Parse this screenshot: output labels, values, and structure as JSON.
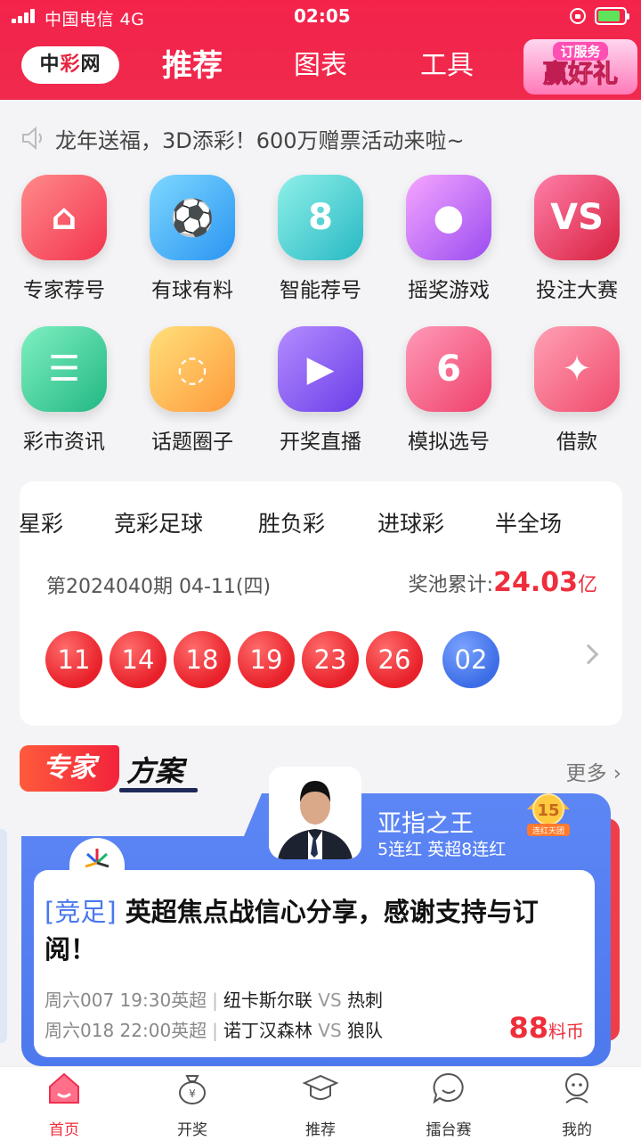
{
  "status_bar": {
    "carrier": "中国电信  4G",
    "time": "02:05"
  },
  "header": {
    "logo": {
      "part1": "中",
      "part2": "彩",
      "part3": "网"
    },
    "tabs": [
      {
        "label": "推荐"
      },
      {
        "label": "图表"
      },
      {
        "label": "工具"
      }
    ],
    "promo": {
      "line1": "订服务",
      "line2": "赢好礼"
    }
  },
  "notice": {
    "text": "龙年送福，3D添彩！600万赠票活动来啦~"
  },
  "grid": {
    "items": [
      {
        "label": "专家荐号",
        "icon": "house-icon"
      },
      {
        "label": "有球有料",
        "icon": "football-icon"
      },
      {
        "label": "智能荐号",
        "icon": "number-8-icon"
      },
      {
        "label": "摇奖游戏",
        "icon": "lottery-ball-icon"
      },
      {
        "label": "投注大赛",
        "icon": "vs-icon"
      },
      {
        "label": "彩市资讯",
        "icon": "news-icon"
      },
      {
        "label": "话题圈子",
        "icon": "topic-circle-icon"
      },
      {
        "label": "开奖直播",
        "icon": "video-play-icon"
      },
      {
        "label": "模拟选号",
        "icon": "dice-6-icon"
      },
      {
        "label": "借款",
        "icon": "money-bag-icon"
      }
    ]
  },
  "lottery": {
    "tabs": [
      "七星彩",
      "竞彩足球",
      "胜负彩",
      "进球彩",
      "半全场"
    ],
    "issue": "第2024040期 04-11(四)",
    "pool_label": "奖池累计:",
    "pool_amount": "24.03",
    "pool_unit": "亿",
    "red_balls": [
      "11",
      "14",
      "18",
      "19",
      "23",
      "26"
    ],
    "blue_balls": [
      "02"
    ]
  },
  "expert_section": {
    "badge": "专家",
    "title": "方案",
    "more": "更多",
    "expert": {
      "name": "亚指之王",
      "sub": "5连红 英超8连红",
      "medal_number": "15",
      "medal_text": "连红天团"
    },
    "plan": {
      "tag": "[竞足]",
      "title": " 英超焦点战信心分享，感谢支持与订阅！",
      "matches": [
        {
          "meta": "周六007 19:30英超",
          "home": "纽卡斯尔联",
          "vs": "VS",
          "away": "热刺"
        },
        {
          "meta": "周六018 22:00英超",
          "home": "诺丁汉森林",
          "vs": "VS",
          "away": "狼队"
        }
      ],
      "price": "88",
      "price_unit": "料币"
    }
  },
  "tabbar": {
    "items": [
      {
        "label": "首页",
        "icon": "home-icon",
        "active": true
      },
      {
        "label": "开奖",
        "icon": "money-bag-icon"
      },
      {
        "label": "推荐",
        "icon": "graduation-cap-icon"
      },
      {
        "label": "擂台赛",
        "icon": "chat-bubble-icon"
      },
      {
        "label": "我的",
        "icon": "user-icon"
      }
    ]
  },
  "colors": {
    "brand": "#f4234b",
    "accent_blue": "#4d79ee",
    "ball_red": "#e82029",
    "ball_blue": "#3c6de6"
  }
}
